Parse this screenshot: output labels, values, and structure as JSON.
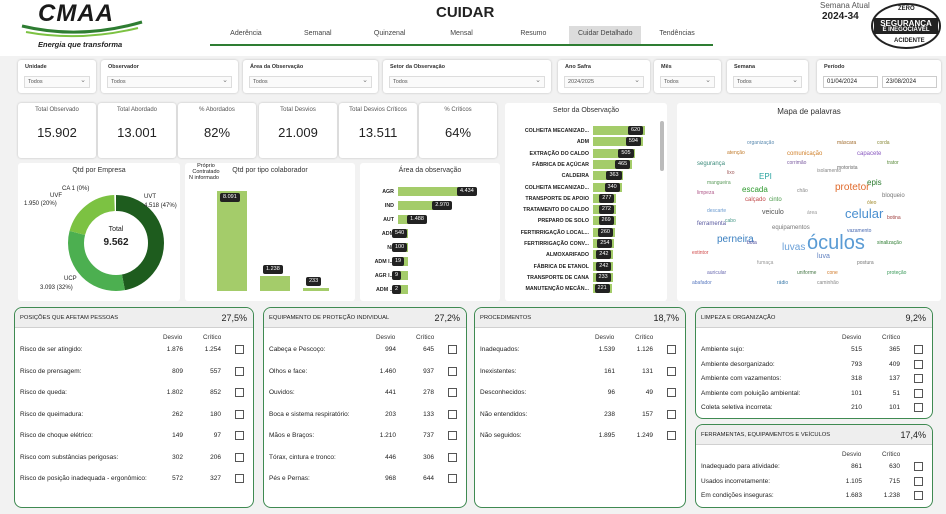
{
  "header": {
    "logo": "CMAA",
    "tagline": "Energia que transforma",
    "title": "CUIDAR",
    "week_label": "Semana Atual",
    "week_value": "2024-34",
    "badge_top": "ZERO",
    "badge_main1": "SEGURANÇA",
    "badge_main2": "É INEGOCIÁVEL",
    "badge_bottom": "ACIDENTE"
  },
  "tabs": [
    "Aderência",
    "Semanal",
    "Quinzenal",
    "Mensal",
    "Resumo",
    "Cuidar Detalhado",
    "Tendências"
  ],
  "active_tab": "Cuidar Detalhado",
  "filters": [
    {
      "label": "Unidade",
      "value": "Todos"
    },
    {
      "label": "Observador",
      "value": "Todos"
    },
    {
      "label": "Área da Observação",
      "value": "Todos"
    },
    {
      "label": "Setor da Observação",
      "value": "Todos"
    },
    {
      "label": "Ano Safra",
      "value": "2024/2025"
    },
    {
      "label": "Mês",
      "value": "Todos"
    },
    {
      "label": "Semana",
      "value": "Todos"
    }
  ],
  "period": {
    "label": "Período",
    "start": "01/04/2024",
    "end": "23/08/2024"
  },
  "kpis": [
    {
      "label": "Total Observado",
      "value": "15.902"
    },
    {
      "label": "Total Abordado",
      "value": "13.001"
    },
    {
      "label": "% Abordados",
      "value": "82%"
    },
    {
      "label": "Total Desvios",
      "value": "21.009"
    },
    {
      "label": "Total Desvios Críticos",
      "value": "13.511"
    },
    {
      "label": "% Críticos",
      "value": "64%"
    }
  ],
  "donut": {
    "title": "Qtd por Empresa",
    "center_label": "Total",
    "center_value": "9.562",
    "labels": [
      {
        "name": "CA 1 (0%)"
      },
      {
        "name": "UVF",
        "value": "1.950 (20%)"
      },
      {
        "name": "UVT",
        "value": "4.518 (47%)"
      },
      {
        "name": "UCP",
        "value": "3.093 (32%)"
      }
    ]
  },
  "collab": {
    "title": "Qtd por tipo colaborador",
    "categories": [
      "Próprio",
      "Contratado",
      "N informado"
    ],
    "values": [
      8091,
      1238,
      233
    ],
    "value_labels": [
      "8.091",
      "1.238",
      "233"
    ]
  },
  "area": {
    "title": "Área da observação",
    "categories": [
      "AGR",
      "IND",
      "AUT",
      "ADM",
      "N/I",
      "ADM I...",
      "AGR I...",
      "ADM ..."
    ],
    "values": [
      4434,
      2970,
      1488,
      540,
      100,
      19,
      9,
      2
    ],
    "value_labels": [
      "4.434",
      "2.970",
      "1.488",
      "540",
      "100",
      "19",
      "9",
      "2"
    ]
  },
  "setor": {
    "title": "Setor da Observação",
    "categories": [
      "COLHEITA MECANIZAD...",
      "ADM",
      "EXTRAÇÃO DO CALDO",
      "FÁBRICA DE AÇÚCAR",
      "CALDEIRA",
      "COLHEITA MECANIZAD...",
      "TRANSPORTE DE APOIO",
      "TRATAMENTO DO CALDO",
      "PREPARO DE SOLO",
      "FERTIRRIGAÇÃO LOCAL...",
      "FERTIRRIGAÇÃO CONV...",
      "ALMOXARIFADO",
      "FÁBRICA DE ETANOL",
      "TRANSPORTE DE CANA",
      "MANUTENÇÃO MECÂN..."
    ],
    "values": [
      620,
      594,
      505,
      465,
      363,
      340,
      277,
      272,
      269,
      260,
      254,
      242,
      242,
      233,
      221
    ]
  },
  "wordcloud": {
    "title": "Mapa de palavras",
    "words": [
      {
        "t": "óculos",
        "s": 20,
        "c": "#5a9bd4"
      },
      {
        "t": "celular",
        "s": 13,
        "c": "#4a8fd0"
      },
      {
        "t": "luvas",
        "s": 10,
        "c": "#6aa0d8"
      },
      {
        "t": "perneira",
        "s": 10,
        "c": "#3a7fc0"
      },
      {
        "t": "protetor",
        "s": 10,
        "c": "#e06a2c"
      },
      {
        "t": "escada",
        "s": 8,
        "c": "#2e9a2e"
      },
      {
        "t": "EPI",
        "s": 8,
        "c": "#2aa4a0"
      },
      {
        "t": "epis",
        "s": 8,
        "c": "#2e7d32"
      },
      {
        "t": "luva",
        "s": 7,
        "c": "#5f80c0"
      },
      {
        "t": "veiculo",
        "s": 7,
        "c": "#555"
      },
      {
        "t": "capacete",
        "s": 6,
        "c": "#8a5ac0"
      },
      {
        "t": "comunicação",
        "s": 6,
        "c": "#d0802a"
      },
      {
        "t": "bloqueio",
        "s": 6,
        "c": "#777"
      },
      {
        "t": "cinto",
        "s": 6,
        "c": "#4a9a4a"
      },
      {
        "t": "calçado",
        "s": 6,
        "c": "#c04a4a"
      },
      {
        "t": "equipamentos",
        "s": 6,
        "c": "#777"
      },
      {
        "t": "ferramenta",
        "s": 6,
        "c": "#5a5aa0"
      },
      {
        "t": "segurança",
        "s": 6,
        "c": "#3a8a7a"
      },
      {
        "t": "máscara",
        "s": 5,
        "c": "#a06a2a"
      },
      {
        "t": "auricular",
        "s": 5,
        "c": "#6a6ab0"
      },
      {
        "t": "caminhão",
        "s": 5,
        "c": "#888"
      },
      {
        "t": "sinalização",
        "s": 5,
        "c": "#2e7d32"
      },
      {
        "t": "limpeza",
        "s": 5,
        "c": "#b05a8a"
      },
      {
        "t": "organização",
        "s": 5,
        "c": "#5a8ab0"
      },
      {
        "t": "botina",
        "s": 5,
        "c": "#a04040"
      },
      {
        "t": "uniforme",
        "s": 5,
        "c": "#4a7a4a"
      },
      {
        "t": "extintor",
        "s": 5,
        "c": "#d04a4a"
      },
      {
        "t": "postura",
        "s": 5,
        "c": "#777"
      },
      {
        "t": "descarte",
        "s": 5,
        "c": "#6a9ad0"
      },
      {
        "t": "isolamento",
        "s": 5,
        "c": "#888"
      },
      {
        "t": "trator",
        "s": 5,
        "c": "#5a8a3a"
      },
      {
        "t": "atenção",
        "s": 5,
        "c": "#c07a2a"
      },
      {
        "t": "vazamento",
        "s": 5,
        "c": "#4a6ab0"
      },
      {
        "t": "fumaça",
        "s": 5,
        "c": "#999"
      },
      {
        "t": "corrimão",
        "s": 5,
        "c": "#7a5aa0"
      },
      {
        "t": "cabo",
        "s": 5,
        "c": "#4a9a8a"
      },
      {
        "t": "óleo",
        "s": 5,
        "c": "#a08a2a"
      },
      {
        "t": "chão",
        "s": 5,
        "c": "#888"
      },
      {
        "t": "abafador",
        "s": 5,
        "c": "#5a7ac0"
      },
      {
        "t": "proteção",
        "s": 5,
        "c": "#3a9a5a"
      },
      {
        "t": "lixo",
        "s": 5,
        "c": "#a05a5a"
      },
      {
        "t": "motorista",
        "s": 5,
        "c": "#6a6a6a"
      },
      {
        "t": "rádio",
        "s": 5,
        "c": "#3a7aaa"
      },
      {
        "t": "cone",
        "s": 5,
        "c": "#d07a2a"
      },
      {
        "t": "mangueira",
        "s": 5,
        "c": "#5a9a5a"
      },
      {
        "t": "corda",
        "s": 5,
        "c": "#8a8a3a"
      },
      {
        "t": "bota",
        "s": 5,
        "c": "#4a4a9a"
      },
      {
        "t": "área",
        "s": 5,
        "c": "#999"
      }
    ]
  },
  "cards": [
    {
      "title": "POSIÇÕES QUE AFETAM PESSOAS",
      "pct": "27,5%",
      "col_d": "Desvio",
      "col_c": "Crítico",
      "rows": [
        {
          "l": "Risco de ser atingido:",
          "d": "1.876",
          "c": "1.254"
        },
        {
          "l": "Risco de prensagem:",
          "d": "809",
          "c": "557"
        },
        {
          "l": "Risco de queda:",
          "d": "1.802",
          "c": "852"
        },
        {
          "l": "Risco de queimadura:",
          "d": "262",
          "c": "180"
        },
        {
          "l": "Risco de choque elétrico:",
          "d": "149",
          "c": "97"
        },
        {
          "l": "Risco com substâncias perigosas:",
          "d": "302",
          "c": "206"
        },
        {
          "l": "Risco de posição inadequada - ergonômico:",
          "d": "572",
          "c": "327"
        }
      ]
    },
    {
      "title": "EQUIPAMENTO DE PROTEÇÃO INDIVIDUAL",
      "pct": "27,2%",
      "col_d": "Desvio",
      "col_c": "Crítico",
      "rows": [
        {
          "l": "Cabeça e Pescoço:",
          "d": "994",
          "c": "645"
        },
        {
          "l": "Olhos e face:",
          "d": "1.460",
          "c": "937"
        },
        {
          "l": "Ouvidos:",
          "d": "441",
          "c": "278"
        },
        {
          "l": "Boca e sistema respiratório:",
          "d": "203",
          "c": "133"
        },
        {
          "l": "Mãos e Braços:",
          "d": "1.210",
          "c": "737"
        },
        {
          "l": "Tórax, cintura e tronco:",
          "d": "446",
          "c": "306"
        },
        {
          "l": "Pés e Pernas:",
          "d": "968",
          "c": "644"
        }
      ]
    },
    {
      "title": "PROCEDIMENTOS",
      "pct": "18,7%",
      "col_d": "Desvio",
      "col_c": "Crítico",
      "rows": [
        {
          "l": "Inadequados:",
          "d": "1.539",
          "c": "1.126"
        },
        {
          "l": "Inexistentes:",
          "d": "161",
          "c": "131"
        },
        {
          "l": "Desconhecidos:",
          "d": "96",
          "c": "49"
        },
        {
          "l": "Não entendidos:",
          "d": "238",
          "c": "157"
        },
        {
          "l": "Não seguidos:",
          "d": "1.895",
          "c": "1.249"
        }
      ]
    },
    {
      "title": "LIMPEZA E ORGANIZAÇÃO",
      "pct": "9,2%",
      "col_d": "Desvio",
      "col_c": "Crítico",
      "rows": [
        {
          "l": "Ambiente sujo:",
          "d": "515",
          "c": "365"
        },
        {
          "l": "Ambiente desorganizado:",
          "d": "793",
          "c": "409"
        },
        {
          "l": "Ambiente com vazamentos:",
          "d": "318",
          "c": "137"
        },
        {
          "l": "Ambiente com poluição ambiental:",
          "d": "101",
          "c": "51"
        },
        {
          "l": "Coleta seletiva incorreta:",
          "d": "210",
          "c": "101"
        }
      ]
    },
    {
      "title": "FERRAMENTAS, EQUIPAMENTOS E VEÍCULOS",
      "pct": "17,4%",
      "col_d": "Desvio",
      "col_c": "Crítico",
      "rows": [
        {
          "l": "Inadequado para atividade:",
          "d": "861",
          "c": "630"
        },
        {
          "l": "Usados incorretamente:",
          "d": "1.105",
          "c": "715"
        },
        {
          "l": "Em condições inseguras:",
          "d": "1.683",
          "c": "1.238"
        }
      ]
    }
  ],
  "colors": {
    "accent": "#2e7d32",
    "bar": "#a4cc6a",
    "donut_dark": "#1e5c1e",
    "donut_mid": "#4caf50",
    "donut_light": "#7cc242"
  }
}
